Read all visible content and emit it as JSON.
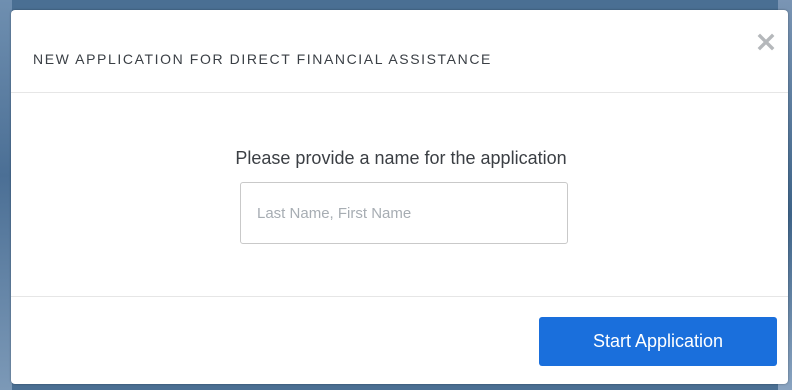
{
  "modal": {
    "title": "NEW APPLICATION FOR DIRECT FINANCIAL ASSISTANCE",
    "close_icon": "close-icon",
    "prompt": "Please provide a name for the application",
    "name_input": {
      "value": "",
      "placeholder": "Last Name, First Name"
    },
    "start_button_label": "Start Application"
  },
  "colors": {
    "primary_button": "#1a6fdc",
    "title_text": "#3a3f45",
    "divider": "#e6e6e6",
    "backdrop": "#4a6f93"
  }
}
